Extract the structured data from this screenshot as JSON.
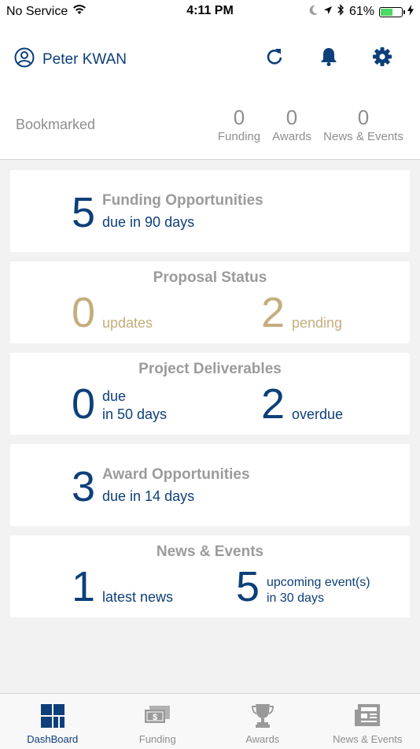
{
  "status_bar": {
    "carrier": "No Service",
    "time": "4:11 PM",
    "battery": "61%",
    "battery_level": 0.61
  },
  "header": {
    "user_name": "Peter KWAN",
    "bookmarked_label": "Bookmarked",
    "stats": [
      {
        "value": "0",
        "label": "Funding"
      },
      {
        "value": "0",
        "label": "Awards"
      },
      {
        "value": "0",
        "label": "News & Events"
      }
    ]
  },
  "cards": {
    "funding": {
      "count": "5",
      "title": "Funding Opportunities",
      "subtitle": "due in 90 days"
    },
    "proposal": {
      "title": "Proposal Status",
      "updates_count": "0",
      "updates_label": "updates",
      "pending_count": "2",
      "pending_label": "pending"
    },
    "deliverables": {
      "title": "Project Deliverables",
      "due_count": "0",
      "due_label_1": "due",
      "due_label_2": "in 50 days",
      "overdue_count": "2",
      "overdue_label": "overdue"
    },
    "awards": {
      "count": "3",
      "title": "Award Opportunities",
      "subtitle": "due in 14 days"
    },
    "news": {
      "title": "News & Events",
      "news_count": "1",
      "news_label": "latest news",
      "events_count": "5",
      "events_label_1": "upcoming event(s)",
      "events_label_2": "in 30 days"
    }
  },
  "tabs": [
    {
      "label": "DashBoard",
      "icon": "dashboard-icon",
      "active": true
    },
    {
      "label": "Funding",
      "icon": "money-icon",
      "active": false
    },
    {
      "label": "Awards",
      "icon": "trophy-icon",
      "active": false
    },
    {
      "label": "News & Events",
      "icon": "newspaper-icon",
      "active": false
    }
  ],
  "colors": {
    "primary": "#0d3f7a",
    "gold": "#c4ae7d",
    "muted": "#9b9b9b"
  }
}
